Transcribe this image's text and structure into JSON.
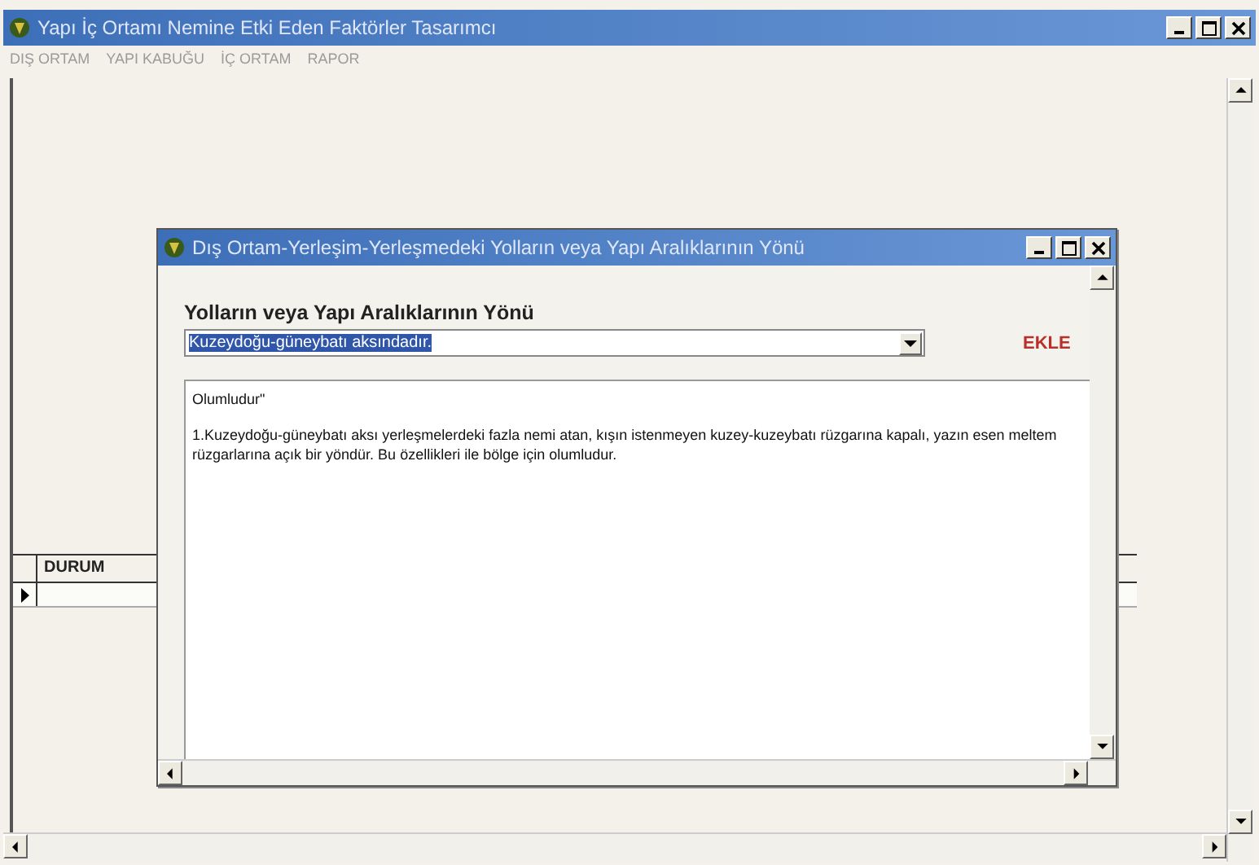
{
  "window": {
    "title": "Yapı İç Ortamı Nemine  Etki Eden Faktörler  Tasarımcı"
  },
  "menu": [
    {
      "label": "DIŞ ORTAM"
    },
    {
      "label": "YAPI KABUĞU"
    },
    {
      "label": "İÇ ORTAM"
    },
    {
      "label": "RAPOR"
    }
  ],
  "grid": {
    "columns": [
      "DURUM"
    ],
    "rows": [
      {
        "current": true
      }
    ]
  },
  "dialog": {
    "title": "Dış Ortam-Yerleşim-Yerleşmedeki  Yolların veya Yapı Aralıklarının Yönü",
    "heading": "Yolların veya Yapı Aralıklarının Yönü",
    "combo": {
      "value": "Kuzeydoğu-güneybatı aksındadır.",
      "text_selected": true
    },
    "add_button": "EKLE",
    "result": {
      "title": "Olumludur\"",
      "paragraph": "1.Kuzeydoğu-güneybatı aksı  yerleşmelerdeki fazla nemi atan, kışın istenmeyen kuzey-kuzeybatı rüzgarına kapalı, yazın esen meltem rüzgarlarına açık bir yöndür.  Bu özellikleri ile bölge için olumludur."
    }
  }
}
